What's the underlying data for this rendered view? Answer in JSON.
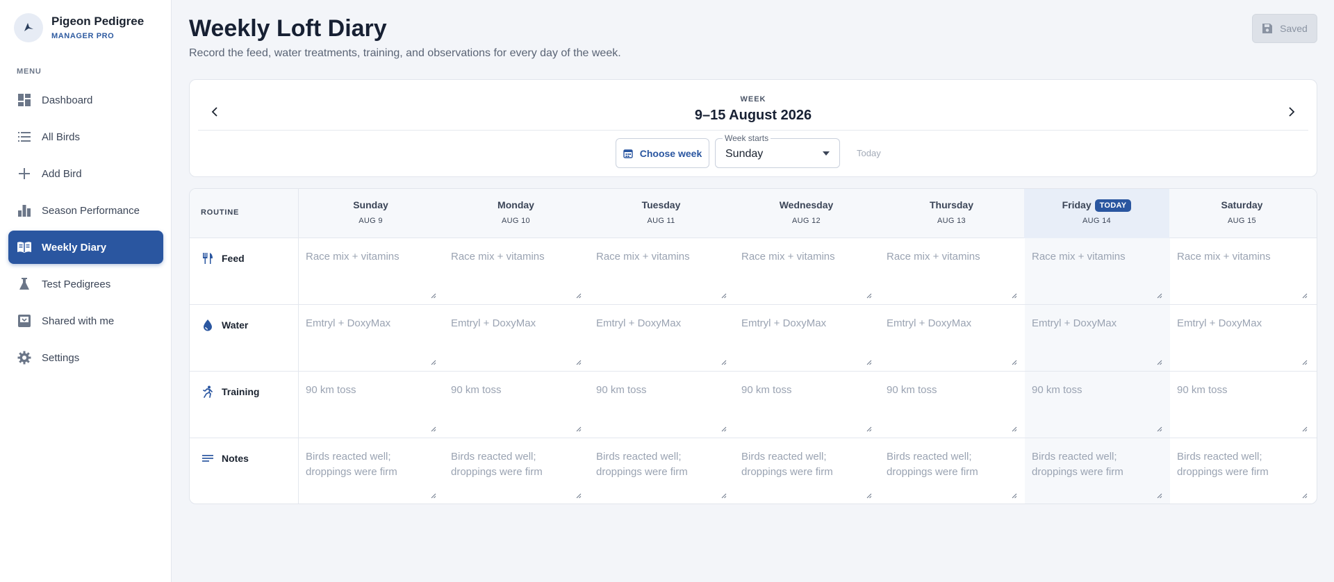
{
  "brand": {
    "name": "Pigeon Pedigree",
    "sub": "MANAGER PRO"
  },
  "menu_label": "MENU",
  "nav": [
    {
      "label": "Dashboard",
      "icon": "dashboard-icon",
      "active": false
    },
    {
      "label": "All Birds",
      "icon": "list-icon",
      "active": false
    },
    {
      "label": "Add Bird",
      "icon": "plus-icon",
      "active": false
    },
    {
      "label": "Season Performance",
      "icon": "bar-chart-icon",
      "active": false
    },
    {
      "label": "Weekly Diary",
      "icon": "book-icon",
      "active": true
    },
    {
      "label": "Test Pedigrees",
      "icon": "flask-icon",
      "active": false
    },
    {
      "label": "Shared with me",
      "icon": "inbox-icon",
      "active": false
    },
    {
      "label": "Settings",
      "icon": "gear-icon",
      "active": false
    }
  ],
  "header": {
    "title": "Weekly Loft Diary",
    "subtitle": "Record the feed, water treatments, training, and observations for every day of the week.",
    "saved_label": "Saved"
  },
  "week": {
    "label": "WEEK",
    "range": "9–15 August 2026",
    "choose_label": "Choose week",
    "starts_label": "Week starts",
    "starts_value": "Sunday",
    "today_label": "Today"
  },
  "grid": {
    "routine_header": "ROUTINE",
    "today_badge": "TODAY",
    "days": [
      {
        "name": "Sunday",
        "date": "AUG 9",
        "today": false
      },
      {
        "name": "Monday",
        "date": "AUG 10",
        "today": false
      },
      {
        "name": "Tuesday",
        "date": "AUG 11",
        "today": false
      },
      {
        "name": "Wednesday",
        "date": "AUG 12",
        "today": false
      },
      {
        "name": "Thursday",
        "date": "AUG 13",
        "today": false
      },
      {
        "name": "Friday",
        "date": "AUG 14",
        "today": true
      },
      {
        "name": "Saturday",
        "date": "AUG 15",
        "today": false
      }
    ],
    "rows": [
      {
        "label": "Feed",
        "icon": "fork-knife-icon",
        "placeholder": "Race mix + vitamins"
      },
      {
        "label": "Water",
        "icon": "water-drop-icon",
        "placeholder": "Emtryl + DoxyMax"
      },
      {
        "label": "Training",
        "icon": "running-icon",
        "placeholder": "90 km toss"
      },
      {
        "label": "Notes",
        "icon": "notes-icon",
        "placeholder": "Birds reacted well; droppings were firm"
      }
    ]
  },
  "colors": {
    "accent": "#2a56a0",
    "today_bg": "#e8eef8"
  }
}
